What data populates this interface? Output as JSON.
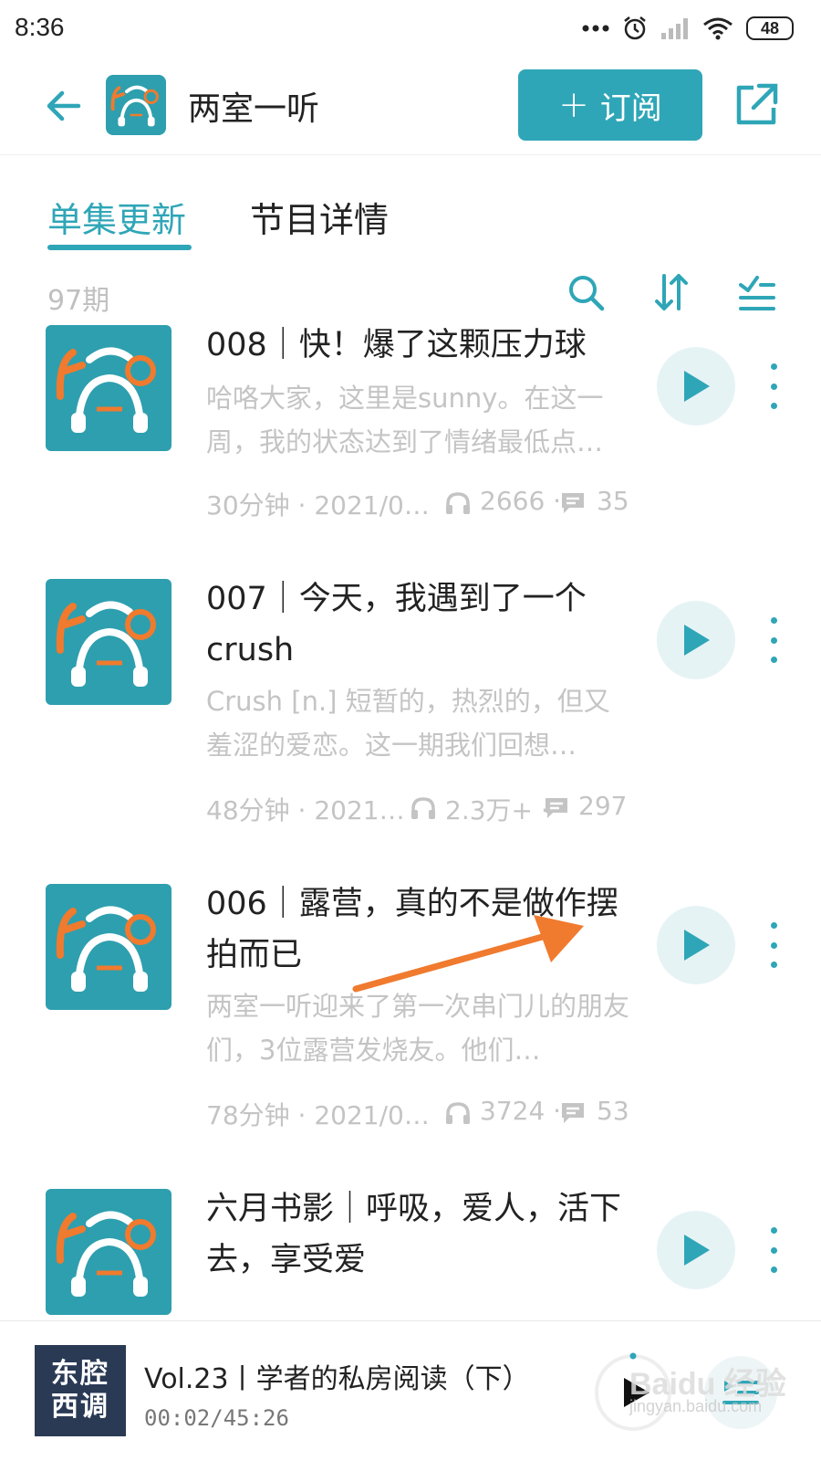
{
  "status_bar": {
    "time": "8:36",
    "battery": "48"
  },
  "header": {
    "title": "两室一听",
    "subscribe_label": "订阅"
  },
  "tabs": [
    {
      "label": "单集更新"
    },
    {
      "label": "节目详情"
    }
  ],
  "toolbar": {
    "episode_count": "97期"
  },
  "episodes": [
    {
      "title": "008｜快！爆了这颗压力球",
      "description": "哈咯大家，这里是sunny。在这一周，我的状态达到了情绪最低点…",
      "duration_date": "30分钟 · 2021/0…",
      "plays": "2666 ·",
      "comments": "35"
    },
    {
      "title": "007｜今天，我遇到了一个crush",
      "description": "Crush [n.] 短暂的，热烈的，但又羞涩的爱恋。这一期我们回想…",
      "duration_date": "48分钟 · 2021…",
      "plays": "2.3万+ ·",
      "comments": "297"
    },
    {
      "title": "006｜露营，真的不是做作摆拍而已",
      "description": "两室一听迎来了第一次串门儿的朋友们，3位露营发烧友。他们…",
      "duration_date": "78分钟 · 2021/0…",
      "plays": "3724 ·",
      "comments": "53"
    },
    {
      "title": "六月书影｜呼吸，爱人，活下去，享受爱"
    }
  ],
  "player": {
    "album_line1": "东腔",
    "album_line2": "西调",
    "now_playing": "Vol.23丨学者的私房阅读（下）",
    "time": "00:02/45:26"
  },
  "watermark": {
    "brand": "Baidu 经验",
    "url": "jingyan.baidu.com"
  },
  "colors": {
    "accent": "#2fa6b7",
    "annotation_arrow": "#f07a2e",
    "album_bg": "#2a3a55"
  },
  "icons": [
    "back-arrow-icon",
    "plus-icon",
    "share-icon",
    "search-icon",
    "sort-icon",
    "filter-list-icon",
    "play-icon",
    "more-vertical-icon",
    "headphones-icon",
    "comment-icon",
    "playlist-icon"
  ]
}
